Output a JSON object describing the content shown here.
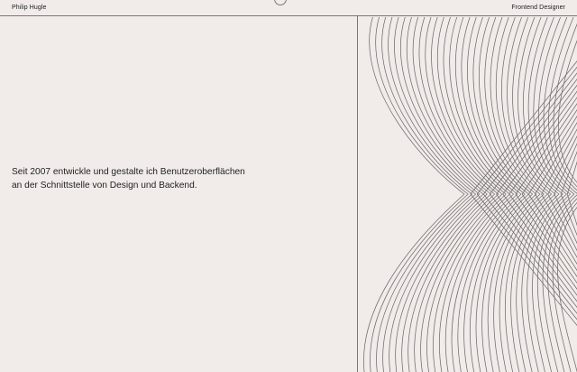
{
  "header": {
    "name": "Philip Hugle",
    "role": "Frontend Designer"
  },
  "intro": {
    "line1": "Seit 2007 entwickle und gestalte ich Benutzeroberflächen",
    "line2": "an der Schnittstelle von Design und Backend."
  },
  "colors": {
    "background": "#f1ecea",
    "text": "#1c1c1c",
    "line": "#7b7776"
  }
}
